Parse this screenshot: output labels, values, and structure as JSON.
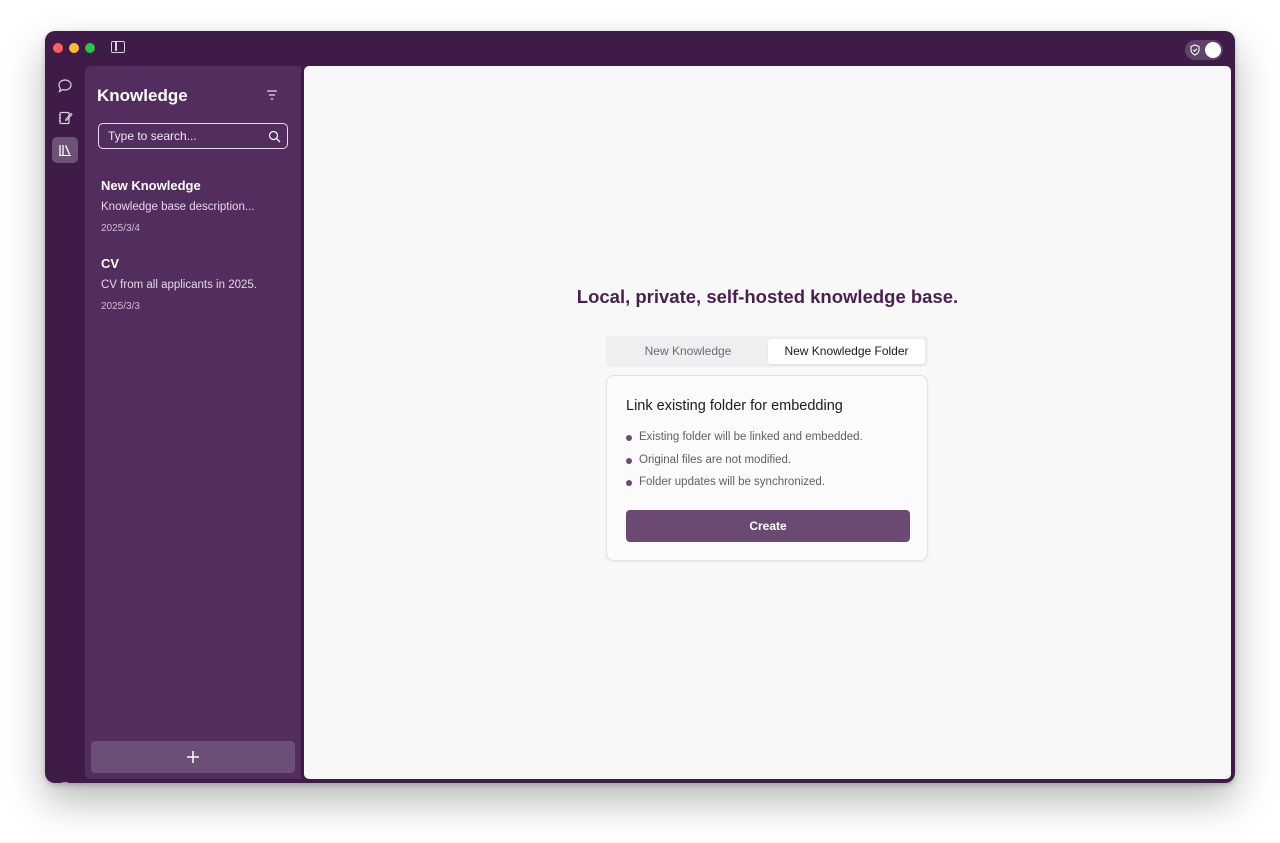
{
  "window": {
    "colors": {
      "window_bg": "#3f1c47",
      "panel_bg": "#532d5d",
      "accent": "#6a4a72",
      "headline": "#4b1f4f"
    }
  },
  "rail": {
    "items": [
      {
        "icon": "chat-bubble-icon",
        "active": false
      },
      {
        "icon": "notes-edit-icon",
        "active": false
      },
      {
        "icon": "library-icon",
        "active": true
      }
    ],
    "footer_icon": "user-circle-icon"
  },
  "sidebar": {
    "title": "Knowledge",
    "search_placeholder": "Type to search...",
    "items": [
      {
        "title": "New Knowledge",
        "description": "Knowledge base description...",
        "date": "2025/3/4"
      },
      {
        "title": "CV",
        "description": "CV from all applicants in 2025.",
        "date": "2025/3/3"
      }
    ],
    "add_button_icon": "plus-icon"
  },
  "main": {
    "headline": "Local, private, self-hosted knowledge base.",
    "tabs": [
      {
        "label": "New Knowledge",
        "selected": false
      },
      {
        "label": "New Knowledge Folder",
        "selected": true
      }
    ],
    "card": {
      "title": "Link existing folder for embedding",
      "bullets": [
        "Existing folder will be linked and embedded.",
        "Original files are not modified.",
        "Folder updates will be synchronized."
      ],
      "button_label": "Create"
    }
  }
}
